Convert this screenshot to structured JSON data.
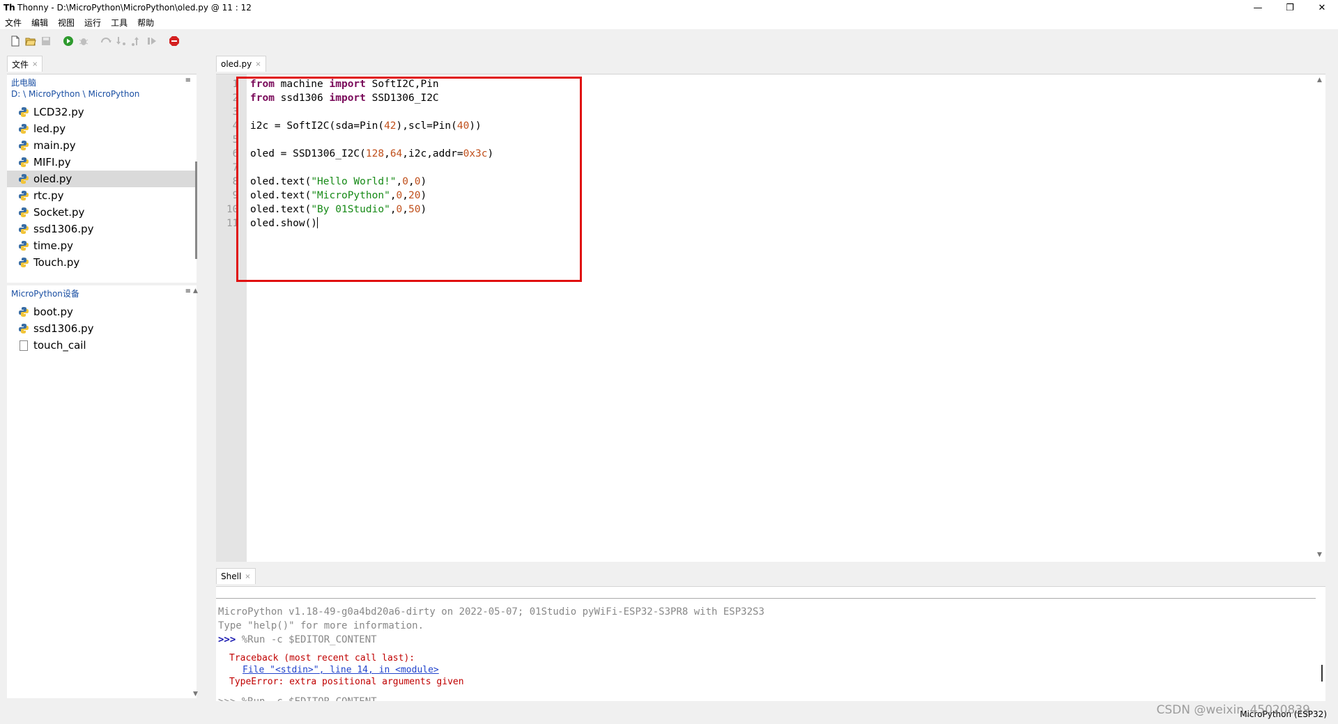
{
  "window": {
    "app_name": "Thonny",
    "separator": "-",
    "path": "D:\\MicroPython\\MicroPython\\oled.py",
    "cursor_pos": "@  11 : 12"
  },
  "menu": [
    "文件",
    "编辑",
    "视图",
    "运行",
    "工具",
    "帮助"
  ],
  "toolbar": {
    "icons": [
      "new-file-icon",
      "open-file-icon",
      "save-icon",
      "run-icon",
      "debug-icon",
      "step-over-icon",
      "step-into-icon",
      "step-out-icon",
      "resume-icon",
      "stop-icon"
    ]
  },
  "files_tab": {
    "label": "文件",
    "close": "×"
  },
  "local_files": {
    "title": "此电脑",
    "path": "D: \\ MicroPython \\ MicroPython",
    "items": [
      "LCD32.py",
      "led.py",
      "main.py",
      "MIFI.py",
      "oled.py",
      "rtc.py",
      "Socket.py",
      "ssd1306.py",
      "time.py",
      "Touch.py"
    ],
    "selected": "oled.py"
  },
  "device_files": {
    "title": "MicroPython设备",
    "items": [
      "boot.py",
      "ssd1306.py",
      "touch_cail"
    ]
  },
  "editor": {
    "tab_label": "oled.py",
    "line_numbers": [
      "1",
      "2",
      "3",
      "4",
      "5",
      "6",
      "7",
      "8",
      "9",
      "10",
      "11"
    ],
    "code_lines": [
      "from machine import SoftI2C,Pin",
      "from ssd1306 import SSD1306_I2C",
      "",
      "i2c = SoftI2C(sda=Pin(42),scl=Pin(40))",
      "",
      "oled = SSD1306_I2C(128,64,i2c,addr=0x3c)",
      "",
      "oled.text(\"Hello World!\",0,0)",
      "oled.text(\"MicroPython\",0,20)",
      "oled.text(\"By 01Studio\",0,50)",
      "oled.show()"
    ]
  },
  "shell": {
    "tab_label": "Shell",
    "banner": "MicroPython v1.18-49-g0a4bd20a6-dirty on 2022-05-07; 01Studio pyWiFi-ESP32-S3PR8 with ESP32S3",
    "help_hint": "Type \"help()\" for more information.",
    "prompt": ">>>",
    "command": " %Run -c $EDITOR_CONTENT",
    "traceback": "Traceback (most recent call last):",
    "traceback_link": "File \"<stdin>\", line 14, in <module>",
    "error": "TypeError: extra positional arguments given",
    "next_line": ">>> %Run -c $EDITOR_CONTENT"
  },
  "status": {
    "interpreter": "MicroPython (ESP32)"
  },
  "watermark": "CSDN @weixin_45020839"
}
